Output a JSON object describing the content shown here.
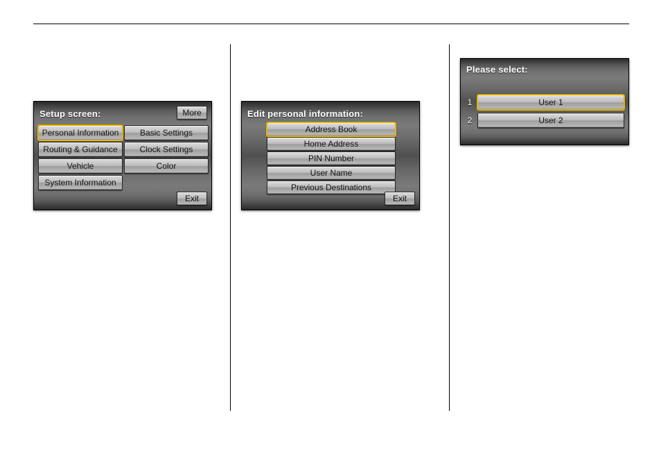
{
  "setup": {
    "title": "Setup screen:",
    "more": "More",
    "exit": "Exit",
    "buttons": [
      "Personal Information",
      "Basic Settings",
      "Routing & Guidance",
      "Clock Settings",
      "Vehicle",
      "Color",
      "System Information"
    ],
    "selected": 0
  },
  "edit": {
    "title": "Edit personal information:",
    "exit": "Exit",
    "items": [
      "Address Book",
      "Home Address",
      "PIN Number",
      "User Name",
      "Previous Destinations"
    ],
    "selected": 0
  },
  "select": {
    "title": "Please select:",
    "users": [
      {
        "num": "1",
        "label": "User 1"
      },
      {
        "num": "2",
        "label": "User 2"
      }
    ],
    "selected": 0
  }
}
